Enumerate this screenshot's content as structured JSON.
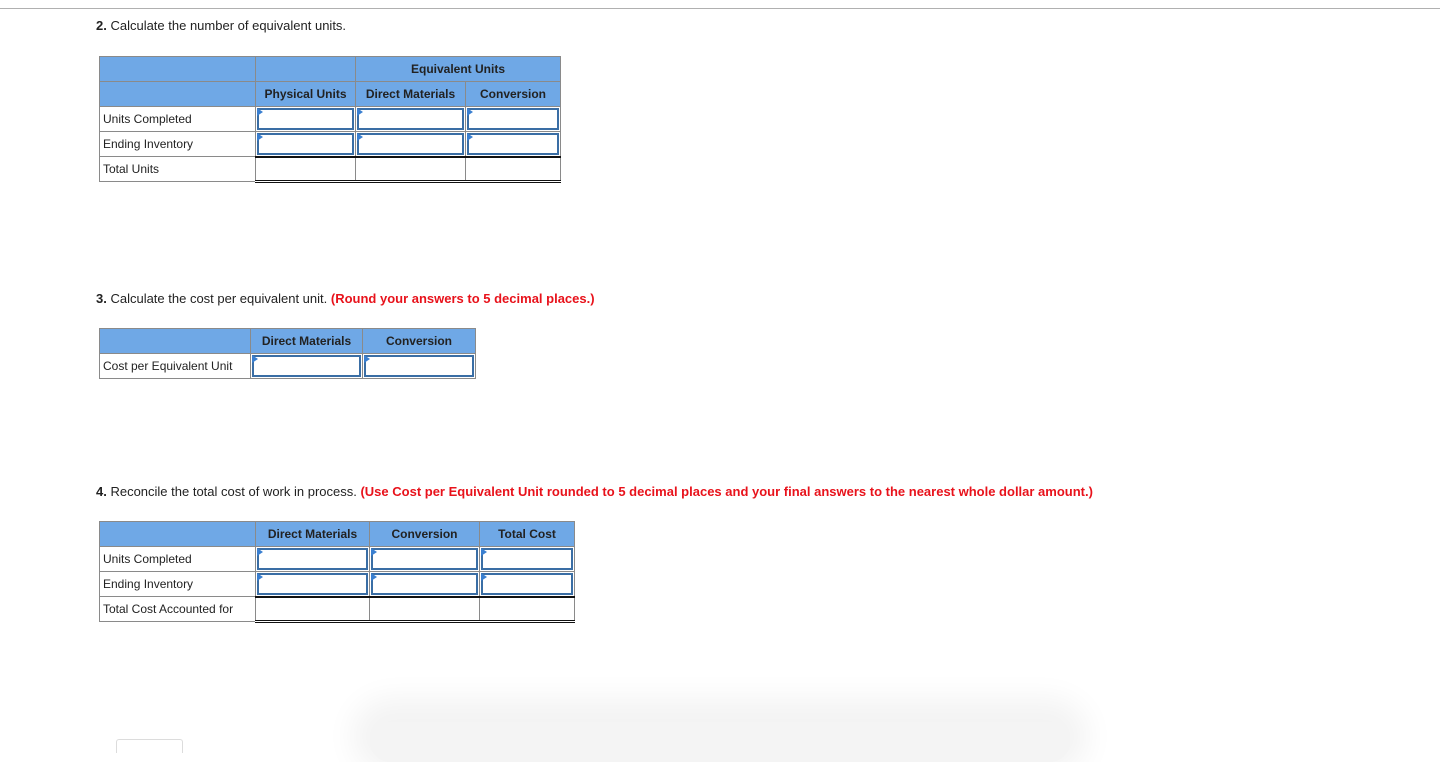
{
  "q2": {
    "number": "2.",
    "text": " Calculate the number of equivalent units.",
    "table": {
      "group_header": "Equivalent Units",
      "columns": [
        "Physical Units",
        "Direct Materials",
        "Conversion"
      ],
      "rows": [
        {
          "label": "Units Completed",
          "values": [
            "",
            "",
            ""
          ]
        },
        {
          "label": "Ending Inventory",
          "values": [
            "",
            "",
            ""
          ]
        },
        {
          "label": "Total Units",
          "values": [
            "",
            "",
            ""
          ]
        }
      ]
    }
  },
  "q3": {
    "number": "3.",
    "text": " Calculate the cost per equivalent unit. ",
    "note": "(Round your answers to 5 decimal places.)",
    "table": {
      "columns": [
        "Direct Materials",
        "Conversion"
      ],
      "rows": [
        {
          "label": "Cost per Equivalent Unit",
          "values": [
            "",
            ""
          ]
        }
      ]
    }
  },
  "q4": {
    "number": "4.",
    "text": " Reconcile the total cost of work in process. ",
    "note": "(Use Cost per Equivalent Unit rounded to 5 decimal places and your final answers to the nearest whole dollar amount.)",
    "table": {
      "columns": [
        "Direct Materials",
        "Conversion",
        "Total Cost"
      ],
      "rows": [
        {
          "label": "Units Completed",
          "values": [
            "",
            "",
            ""
          ]
        },
        {
          "label": "Ending Inventory",
          "values": [
            "",
            "",
            ""
          ]
        },
        {
          "label": "Total Cost Accounted for",
          "values": [
            "",
            "",
            ""
          ]
        }
      ]
    }
  },
  "colors": {
    "header_bg": "#6fa8e6",
    "note_red": "#e8121b",
    "input_border": "#3a6ea5"
  }
}
